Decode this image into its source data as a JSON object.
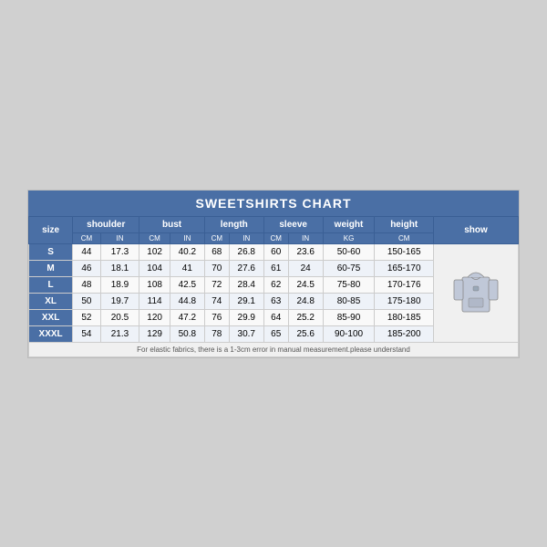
{
  "title": "SWEETSHIRTS CHART",
  "columns": [
    {
      "label": "size",
      "sub": []
    },
    {
      "label": "shoulder",
      "sub": [
        "CM",
        "IN"
      ]
    },
    {
      "label": "bust",
      "sub": [
        "CM",
        "IN"
      ]
    },
    {
      "label": "length",
      "sub": [
        "CM",
        "IN"
      ]
    },
    {
      "label": "sleeve",
      "sub": [
        "CM",
        "IN"
      ]
    },
    {
      "label": "weight",
      "sub": [
        "KG"
      ]
    },
    {
      "label": "height",
      "sub": [
        "CM"
      ]
    },
    {
      "label": "show",
      "sub": []
    }
  ],
  "rows": [
    {
      "size": "S",
      "shoulder_cm": "44",
      "shoulder_in": "17.3",
      "bust_cm": "102",
      "bust_in": "40.2",
      "length_cm": "68",
      "length_in": "26.8",
      "sleeve_cm": "60",
      "sleeve_in": "23.6",
      "weight": "50-60",
      "height": "150-165"
    },
    {
      "size": "M",
      "shoulder_cm": "46",
      "shoulder_in": "18.1",
      "bust_cm": "104",
      "bust_in": "41",
      "length_cm": "70",
      "length_in": "27.6",
      "sleeve_cm": "61",
      "sleeve_in": "24",
      "weight": "60-75",
      "height": "165-170"
    },
    {
      "size": "L",
      "shoulder_cm": "48",
      "shoulder_in": "18.9",
      "bust_cm": "108",
      "bust_in": "42.5",
      "length_cm": "72",
      "length_in": "28.4",
      "sleeve_cm": "62",
      "sleeve_in": "24.5",
      "weight": "75-80",
      "height": "170-176"
    },
    {
      "size": "XL",
      "shoulder_cm": "50",
      "shoulder_in": "19.7",
      "bust_cm": "114",
      "bust_in": "44.8",
      "length_cm": "74",
      "length_in": "29.1",
      "sleeve_cm": "63",
      "sleeve_in": "24.8",
      "weight": "80-85",
      "height": "175-180"
    },
    {
      "size": "XXL",
      "shoulder_cm": "52",
      "shoulder_in": "20.5",
      "bust_cm": "120",
      "bust_in": "47.2",
      "length_cm": "76",
      "length_in": "29.9",
      "sleeve_cm": "64",
      "sleeve_in": "25.2",
      "weight": "85-90",
      "height": "180-185"
    },
    {
      "size": "XXXL",
      "shoulder_cm": "54",
      "shoulder_in": "21.3",
      "bust_cm": "129",
      "bust_in": "50.8",
      "length_cm": "78",
      "length_in": "30.7",
      "sleeve_cm": "65",
      "sleeve_in": "25.6",
      "weight": "90-100",
      "height": "185-200"
    }
  ],
  "note": "For elastic fabrics, there is a 1-3cm error in manual measurement.please understand"
}
